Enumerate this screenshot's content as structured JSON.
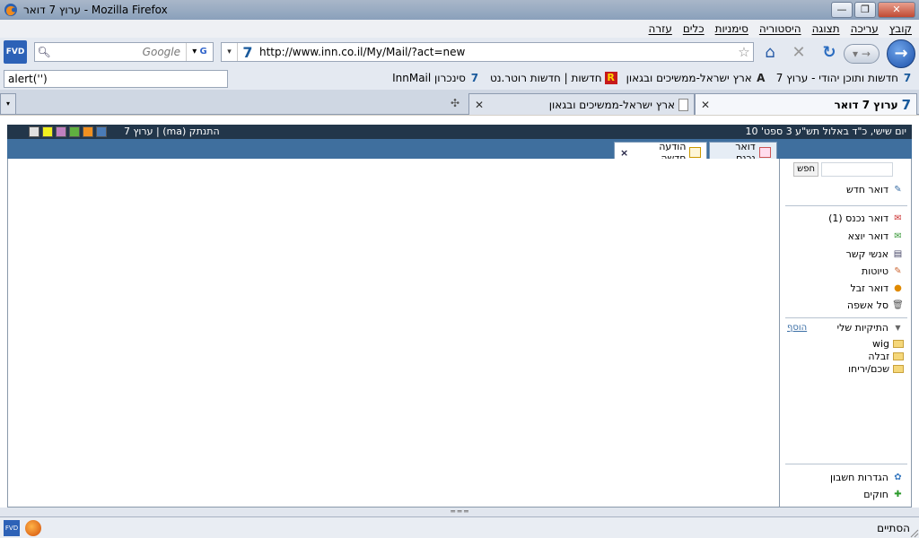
{
  "window": {
    "title": "ערוץ 7 דואר - Mozilla Firefox",
    "minimize": "—",
    "maximize": "❐",
    "close": "✕"
  },
  "menubar": [
    "קובץ",
    "עריכה",
    "תצוגה",
    "היסטוריה",
    "סימניות",
    "כלים",
    "עזרה"
  ],
  "navbar": {
    "fvd_label": "FVD",
    "search_placeholder": "Google",
    "url": "http://www.inn.co.il/My/Mail/?act=new",
    "site_icon": "7"
  },
  "bookmarks_bar": {
    "alert_value": "alert('')",
    "items": [
      {
        "label": "חדשות ותוכן יהודי - ערוץ 7",
        "icon": "7"
      },
      {
        "label": "ארץ ישראל-ממשיכים ובגאון",
        "icon": "A"
      },
      {
        "label": "חדשות | חדשות רוטר.נט",
        "icon": "R"
      },
      {
        "label": "סינכרון InnMail",
        "icon": "7"
      }
    ]
  },
  "tabs": [
    {
      "label": "ערוץ 7 דואר",
      "active": true
    },
    {
      "label": "ארץ ישראל-ממשיכים ובגאון",
      "active": false
    }
  ],
  "page": {
    "date": "יום שישי, כ\"ד באלול תש\"ע 3 ספט' 10",
    "user_info": "התנתק (ma) | ערוץ 7",
    "swatches": [
      "#e0e0e0",
      "#f0f020",
      "#c080c0",
      "#60b040",
      "#f09020"
    ],
    "tabs": {
      "inbox": "דואר נכנס",
      "new_message": "הודעה חדשה",
      "close": "×"
    },
    "sidebar": {
      "search_button": "חפש",
      "new_mail": "דואר חדש",
      "inbox": "דואר נכנס (1)",
      "outbox": "דואר יוצא",
      "contacts": "אנשי קשר",
      "drafts": "טיוטות",
      "spam": "דואר זבל",
      "trash": "סל אשפה",
      "my_folders": "התיקיות שלי",
      "add": "הוסף",
      "folders": [
        "wig",
        "זבלה",
        "שכם/יריחו"
      ],
      "account_settings": "הגדרות חשבון",
      "rules": "חוקים"
    }
  },
  "statusbar": {
    "text": "הסתיים"
  }
}
